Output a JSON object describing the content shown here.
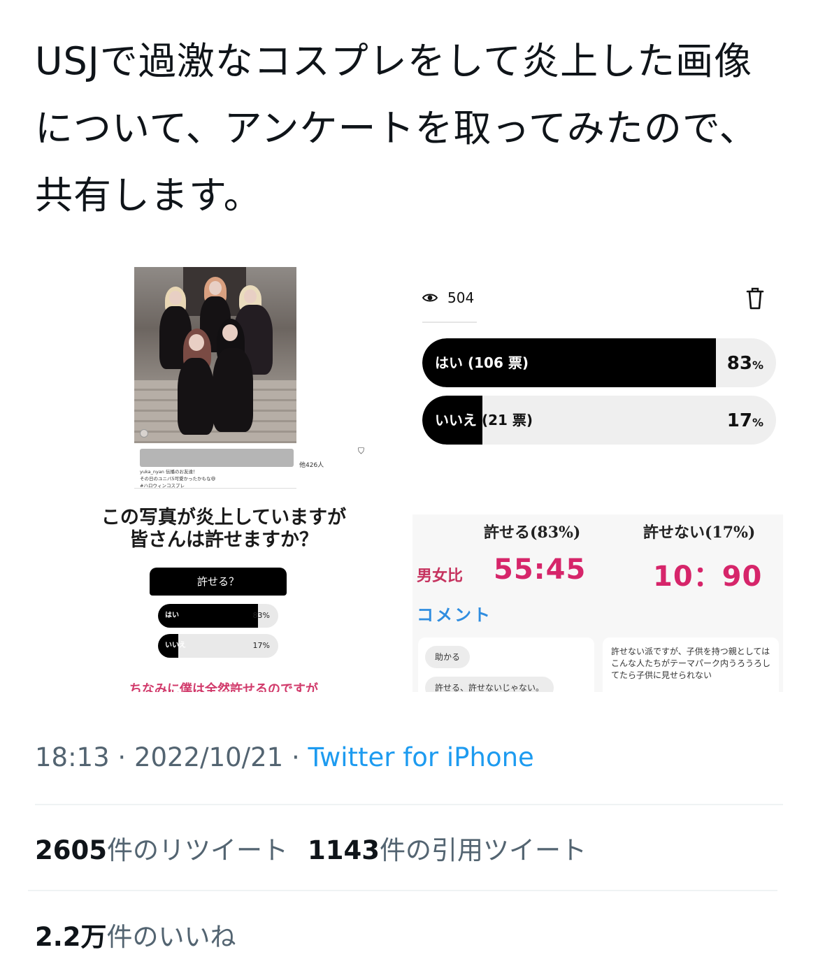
{
  "tweet": {
    "text": "USJで過激なコスプレをして炎上した画像について、アンケートを取ってみたので、共有します。"
  },
  "left_image": {
    "follower_count": "他426人",
    "caption_line1": "yuka_nyan 伝播のお友達！",
    "caption_line2": "その日のユニバ5可愛かったかもな😆",
    "caption_line3": "#ハロウィンコスプレ",
    "question_line1": "この写真が炎上していますが",
    "question_line2": "皆さんは許せますか？",
    "poll_title": "許せる？",
    "option1_label": "はい",
    "option1_pct": "83%",
    "option1_value": 83,
    "option2_label": "いいえ",
    "option2_pct": "17%",
    "option2_value": 17,
    "footnote": "ちなみに僕は全然許せるのですが"
  },
  "poll": {
    "views": "504",
    "option1_label": "はい",
    "option1_votes": "(106 票)",
    "option1_pct": "83",
    "option1_value": 83,
    "option2_label": "いいえ",
    "option2_votes": "(21 票)",
    "option2_pct": "17",
    "option2_value": 17,
    "pct_sign": "%"
  },
  "stats": {
    "head_allow": "許せる(83%)",
    "head_disallow": "許せない(17%)",
    "ratio_label": "男女比",
    "ratio_allow": "55:45",
    "ratio_disallow": "10：90",
    "comment_label": "コメント",
    "comment1_a": "助かる",
    "comment1_b": "許せる、許せないじゃない。",
    "comment2": "許せない派ですが、子供を持つ親としてはこんな人たちがテーマパーク内うろうろしてたら子供に見せられない"
  },
  "meta": {
    "time": "18:13",
    "date": "2022/10/21",
    "separator": " · ",
    "source": "Twitter for iPhone"
  },
  "counts": {
    "retweets": "2605",
    "retweets_label": "件のリツイート",
    "quotes": "1143",
    "quotes_label": "件の引用ツイート",
    "likes": "2.2",
    "likes_unit": "万",
    "likes_label": "件のいいね"
  },
  "colors": {
    "link": "#1d9bf0",
    "muted": "#536471",
    "ratio": "#d6256a",
    "comment_heading": "#2f8de0"
  }
}
